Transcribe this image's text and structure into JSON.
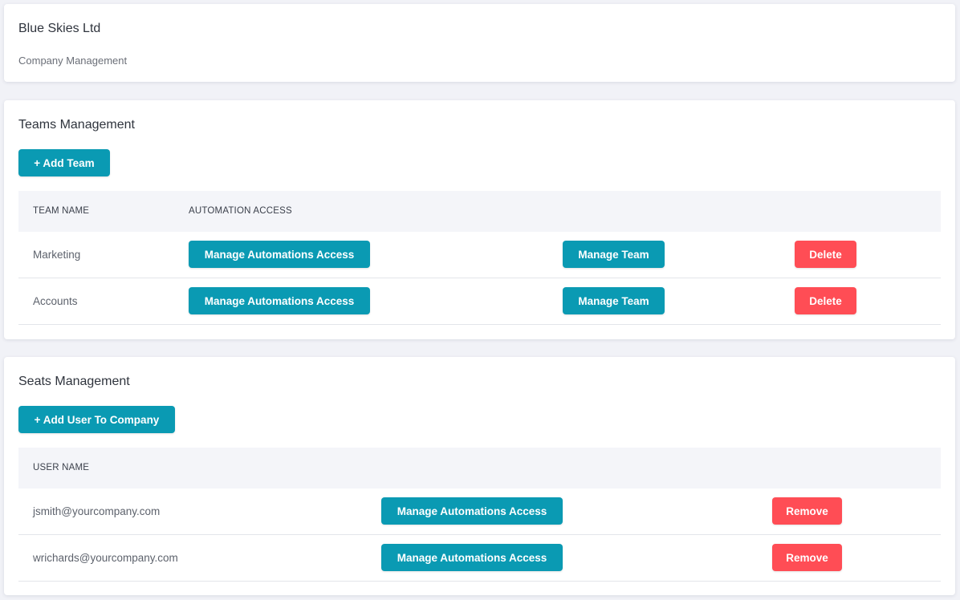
{
  "header": {
    "company_name": "Blue Skies Ltd",
    "subtitle": "Company Management"
  },
  "teams": {
    "title": "Teams Management",
    "add_button": "+ Add Team",
    "columns": [
      "TEAM NAME",
      "AUTOMATION ACCESS"
    ],
    "rows": [
      {
        "name": "Marketing",
        "access_button": "Manage Automations Access",
        "manage_button": "Manage Team",
        "delete_button": "Delete"
      },
      {
        "name": "Accounts",
        "access_button": "Manage Automations Access",
        "manage_button": "Manage Team",
        "delete_button": "Delete"
      }
    ]
  },
  "seats": {
    "title": "Seats Management",
    "add_button": "+ Add User To Company",
    "columns": [
      "USER NAME"
    ],
    "rows": [
      {
        "email": "jsmith@yourcompany.com",
        "access_button": "Manage Automations Access",
        "remove_button": "Remove"
      },
      {
        "email": "wrichards@yourcompany.com",
        "access_button": "Manage Automations Access",
        "remove_button": "Remove"
      }
    ]
  },
  "colors": {
    "accent": "#0a9ab3",
    "danger": "#ff4d55",
    "background": "#f1f2f7"
  }
}
